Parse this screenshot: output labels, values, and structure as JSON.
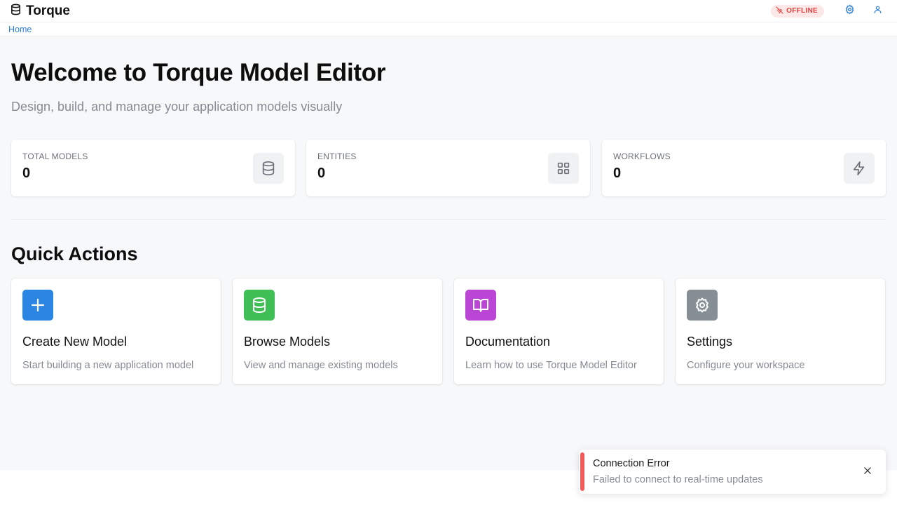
{
  "header": {
    "app_name": "Torque",
    "status_badge": "OFFLINE",
    "icons": {
      "logo": "database-icon",
      "offline": "wifi-off-icon",
      "settings": "gear-icon",
      "user": "user-icon"
    }
  },
  "breadcrumb": {
    "items": [
      "Home"
    ]
  },
  "main": {
    "title": "Welcome to Torque Model Editor",
    "subtitle": "Design, build, and manage your application models visually"
  },
  "stats": [
    {
      "label": "TOTAL MODELS",
      "value": "0",
      "icon": "database-icon"
    },
    {
      "label": "ENTITIES",
      "value": "0",
      "icon": "grid-icon"
    },
    {
      "label": "WORKFLOWS",
      "value": "0",
      "icon": "lightning-icon"
    }
  ],
  "quick_actions": {
    "title": "Quick Actions",
    "items": [
      {
        "title": "Create New Model",
        "description": "Start building a new application model",
        "icon": "plus-icon",
        "color": "#2b86e3"
      },
      {
        "title": "Browse Models",
        "description": "View and manage existing models",
        "icon": "database-icon",
        "color": "#3fbf55"
      },
      {
        "title": "Documentation",
        "description": "Learn how to use Torque Model Editor",
        "icon": "book-icon",
        "color": "#bb46d6"
      },
      {
        "title": "Settings",
        "description": "Configure your workspace",
        "icon": "gear-icon",
        "color": "#868e96"
      }
    ]
  },
  "toast": {
    "title": "Connection Error",
    "message": "Failed to connect to real-time updates",
    "color": "#f25c5c"
  },
  "colors": {
    "accent": "#2b7fd8",
    "offline": "#e53e3e"
  }
}
